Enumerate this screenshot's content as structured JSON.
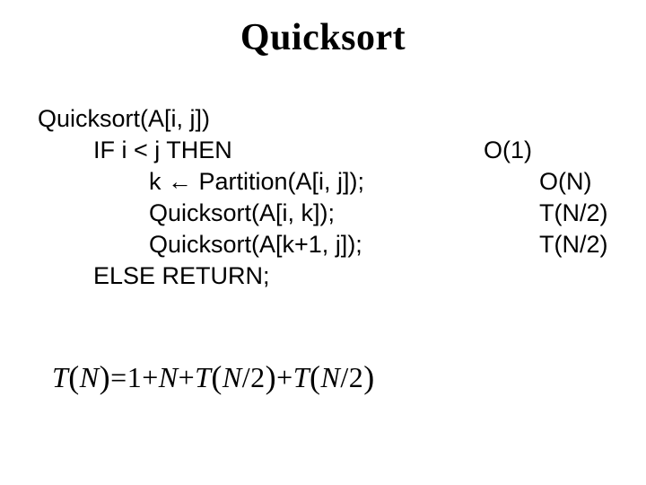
{
  "title": "Quicksort",
  "lines": [
    {
      "code": "Quicksort(A[i, j])",
      "indent": 0,
      "cost": ""
    },
    {
      "code": "IF i < j THEN",
      "indent": 1,
      "cost": "O(1)"
    },
    {
      "code": "k ← Partition(A[i, j]);",
      "indent": 2,
      "cost": "O(N)"
    },
    {
      "code": "Quicksort(A[i, k]);",
      "indent": 2,
      "cost": "T(N/2)"
    },
    {
      "code": "Quicksort(A[k+1, j]);",
      "indent": 2,
      "cost": "T(N/2)"
    },
    {
      "code": "ELSE RETURN;",
      "indent": 1,
      "cost": ""
    }
  ],
  "formula": {
    "lhs_var": "T",
    "lhs_arg": "N",
    "rhs_terms": [
      "1",
      "N",
      "T(N/2)",
      "T(N/2)"
    ]
  },
  "formula_text": "T(N) = 1 + N + T(N/2) + T(N/2)"
}
